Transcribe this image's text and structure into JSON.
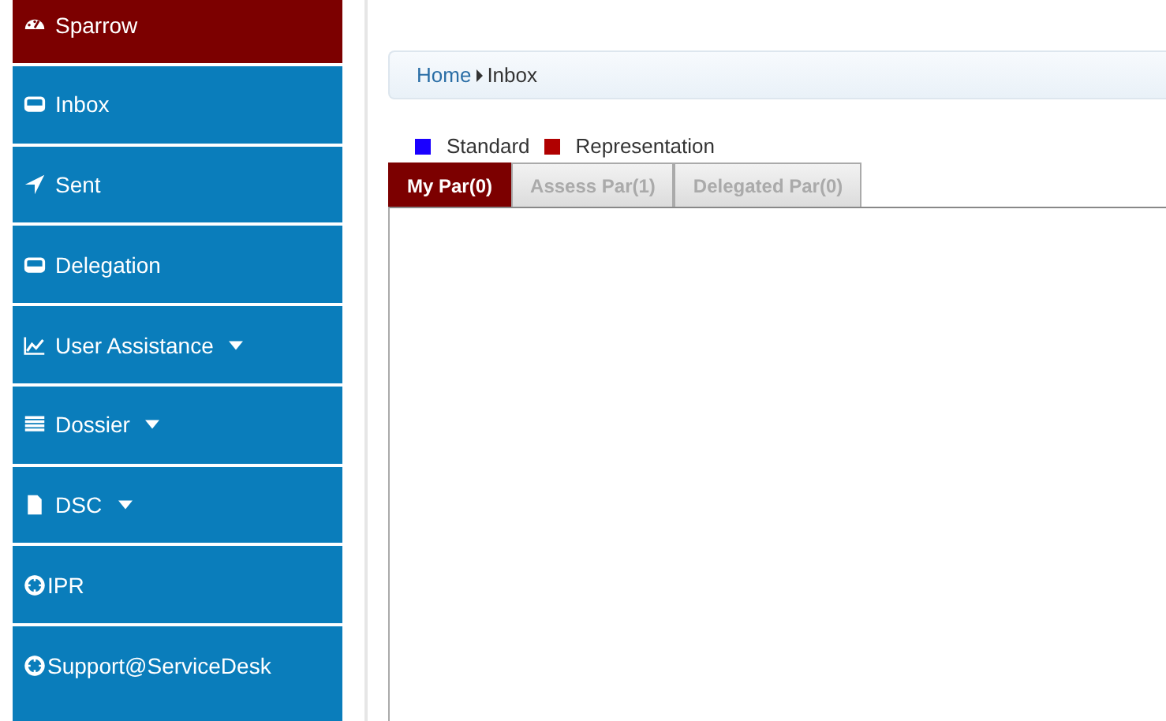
{
  "sidebar": {
    "items": [
      {
        "label": "Sparrow",
        "selected": true,
        "has_menu": false
      },
      {
        "label": "Inbox",
        "selected": false,
        "has_menu": false
      },
      {
        "label": "Sent",
        "selected": false,
        "has_menu": false
      },
      {
        "label": "Delegation",
        "selected": false,
        "has_menu": false
      },
      {
        "label": "User Assistance",
        "selected": false,
        "has_menu": true
      },
      {
        "label": "Dossier",
        "selected": false,
        "has_menu": true
      },
      {
        "label": "DSC",
        "selected": false,
        "has_menu": true
      },
      {
        "label": "IPR",
        "selected": false,
        "has_menu": false
      },
      {
        "label": "Support@ServiceDesk",
        "selected": false,
        "has_menu": false
      }
    ]
  },
  "breadcrumb": [
    "Home",
    "Inbox"
  ],
  "legend": [
    {
      "label": "Standard",
      "color": "#1a00ff"
    },
    {
      "label": "Representation",
      "color": "#b00000"
    }
  ],
  "tabs": [
    {
      "label": "My Par(0)",
      "selected": true
    },
    {
      "label": "Assess Par(1)",
      "selected": false
    },
    {
      "label": "Delegated Par(0)",
      "selected": false
    }
  ]
}
